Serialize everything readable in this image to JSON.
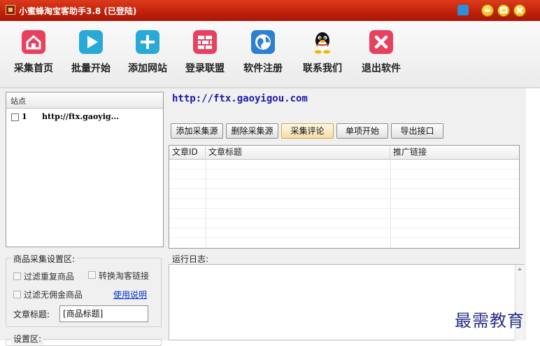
{
  "window": {
    "title": "小蜜蜂淘宝客助手3.8 (已登陆)"
  },
  "toolbar": {
    "items": [
      {
        "label": "采集首页",
        "icon": "home-icon",
        "color": "#e8415f"
      },
      {
        "label": "批量开始",
        "icon": "play-icon",
        "color": "#28a9d6"
      },
      {
        "label": "添加网站",
        "icon": "plus-icon",
        "color": "#28a9d6"
      },
      {
        "label": "登录联盟",
        "icon": "brick-wall-icon",
        "color": "#e8415f"
      },
      {
        "label": "软件注册",
        "icon": "globe-icon",
        "color": "#2d7fd1"
      },
      {
        "label": "联系我们",
        "icon": "qq-penguin-icon",
        "color": "#111111"
      },
      {
        "label": "退出软件",
        "icon": "close-x-icon",
        "color": "#e8415f"
      }
    ]
  },
  "sites": {
    "header": "站点",
    "rows": [
      {
        "index": "1",
        "url": "http://ftx.gaoyig..."
      }
    ]
  },
  "current_url": "http://ftx.gaoyigou.com",
  "actions": {
    "add_source": "添加采集源",
    "delete_source": "删除采集源",
    "collect_comments": "采集评论",
    "start_single": "单项开始",
    "export_api": "导出接口"
  },
  "table": {
    "columns": [
      "文章ID",
      "文章标题",
      "推广链接"
    ]
  },
  "product_settings": {
    "group_title": "商品采集设置区:",
    "filter_duplicates": "过滤重复商品",
    "convert_links": "转换淘客链接",
    "filter_no_commission": "过滤无佣金商品",
    "help_link": "使用说明",
    "article_title_label": "文章标题:",
    "article_title_value": "[商品标题]"
  },
  "settings_area": {
    "group_title": "设置区:"
  },
  "log": {
    "label": "运行日志:"
  },
  "watermark": "最需教育"
}
